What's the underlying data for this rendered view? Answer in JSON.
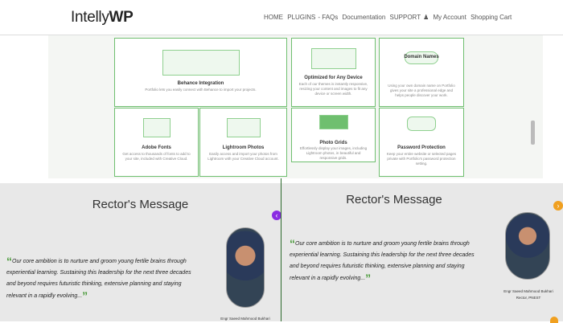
{
  "header": {
    "logo_main": "Intelly",
    "logo_bold": "WP",
    "nav": [
      "HOME",
      "PLUGINS",
      "FAQs",
      "Documentation",
      "SUPPORT",
      "My Account",
      "Shopping Cart"
    ]
  },
  "cards": [
    {
      "title": "Behance Integration",
      "desc": "Portfolio lets you easily connect with Behance to import your projects."
    },
    {
      "title": "Optimized for Any Device",
      "desc": "Each of our themes is instantly responsive, resizing your content and images to fit any device or screen width."
    },
    {
      "title": "Domain Names",
      "desc": "Using your own domain name on Portfolio gives your site a professional edge and helps people discover your work."
    },
    {
      "title": "Adobe Fonts",
      "desc": "Get access to thousands of fonts to add to your site, included with Creative Cloud."
    },
    {
      "title": "Lightroom Photos",
      "desc": "Easily access and import your photos from Lightroom with your Creative Cloud account."
    },
    {
      "title": "Photo Grids",
      "desc": "Effortlessly display your images, including Lightroom photos, in beautiful and responsive grids."
    },
    {
      "title": "Password Protection",
      "desc": "Keep your entire website or selected pages private with Portfolio's password protection setting."
    }
  ],
  "rector_left": {
    "title": "Rector's Message",
    "quote": "Our core ambition is to nurture and groom young fertile brains through experiential learning. Sustaining this leadership for the next three decades and beyond requires futuristic thinking, extensive planning and staying relevant in a rapidly evolving...",
    "name": "Engr Saeed Mahmood Bukhari"
  },
  "rector_right": {
    "title": "Rector's Message",
    "quote": "Our core ambition is to nurture and groom young fertile brains through experiential learning. Sustaining this leadership for the next three decades and beyond requires futuristic thinking, extensive planning and staying relevant in a rapidly evolving...",
    "name": "Engr Saeed Mahmood Bukhari",
    "role": "Rector, PNEST"
  },
  "icons": {
    "prev": "chevron-left-icon",
    "next": "chevron-right-icon"
  },
  "colors": {
    "accent": "#6fbf6f",
    "arrow_left": "#8a2be2",
    "arrow_right": "#f0a020"
  }
}
